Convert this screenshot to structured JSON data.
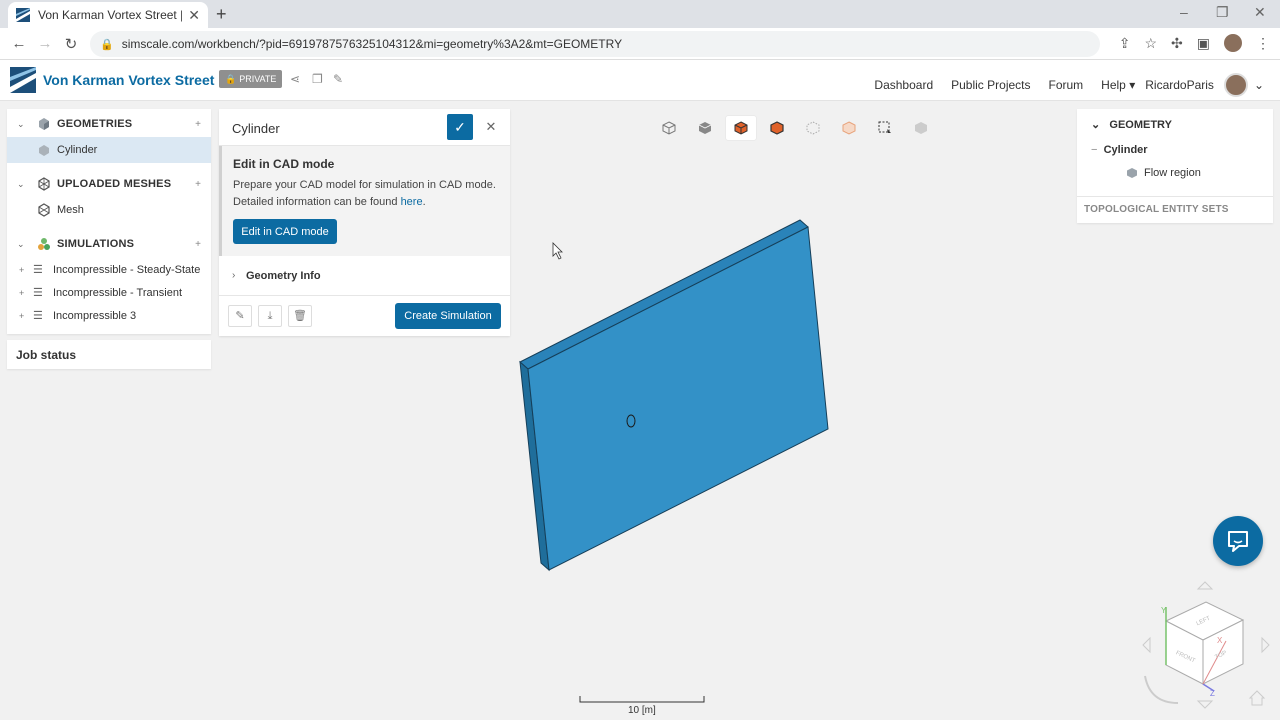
{
  "browser": {
    "tab_title": "Von Karman Vortex Street | SimSc",
    "url": "simscale.com/workbench/?pid=6919787576325104312&mi=geometry%3A2&mt=GEOMETRY",
    "new_tab": "+",
    "tab_close": "✕"
  },
  "app": {
    "project_title": "Von Karman Vortex Street",
    "badge": "PRIVATE",
    "nav": [
      "Dashboard",
      "Public Projects",
      "Forum",
      "Help"
    ],
    "user": "RicardoParis"
  },
  "left_tree": {
    "geometries": {
      "label": "GEOMETRIES",
      "items": [
        "Cylinder"
      ]
    },
    "meshes": {
      "label": "UPLOADED MESHES",
      "items": [
        "Mesh"
      ]
    },
    "simulations": {
      "label": "SIMULATIONS",
      "items": [
        "Incompressible - Steady-State",
        "Incompressible - Transient",
        "Incompressible 3"
      ]
    },
    "job_status": "Job status"
  },
  "panel": {
    "title": "Cylinder",
    "cad_title": "Edit in CAD mode",
    "cad_text": "Prepare your CAD model for simulation in CAD mode. Detailed information can be found ",
    "cad_link": "here",
    "cad_period": ".",
    "cad_button": "Edit in CAD mode",
    "geometry_info": "Geometry Info",
    "create_button": "Create Simulation"
  },
  "right_tree": {
    "header": "GEOMETRY",
    "root": "Cylinder",
    "child": "Flow region",
    "topological": "TOPOLOGICAL ENTITY SETS"
  },
  "viewport": {
    "scale_label": "10 [m]",
    "cube_faces": [
      "LEFT",
      "TOP",
      "FRONT"
    ],
    "axes": [
      "Y",
      "X",
      "Z"
    ]
  },
  "colors": {
    "accent": "#0c6ba2",
    "model_face": "#2f8fc6",
    "model_edge": "#1d5f86",
    "model_dark": "#1f6e9b"
  }
}
